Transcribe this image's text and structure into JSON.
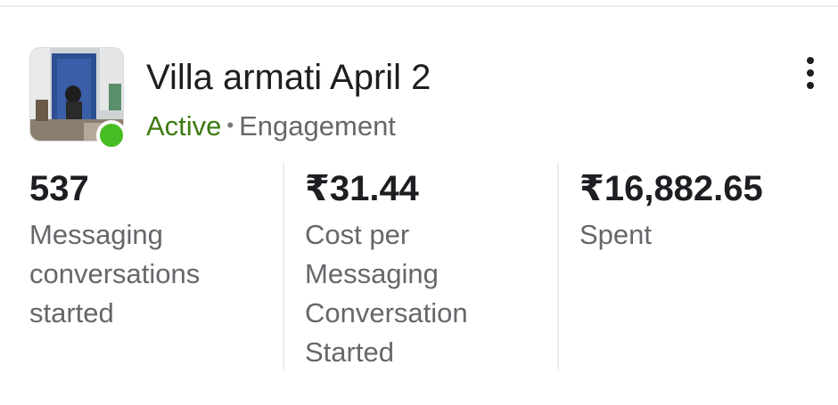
{
  "campaign": {
    "title": "Villa armati April 2",
    "status": "Active",
    "separator": "•",
    "objective": "Engagement",
    "thumbnail_icon": "campaign-thumbnail-image",
    "status_color": "#45bd25",
    "status_text_color": "#3d7b12"
  },
  "menu": {
    "icon": "more-vertical-icon"
  },
  "metrics": [
    {
      "value": "537",
      "label_lines": [
        "Messaging",
        "conversations",
        "started"
      ]
    },
    {
      "value": "₹31.44",
      "label_lines": [
        "Cost per",
        "Messaging",
        "Conversation",
        "Started"
      ]
    },
    {
      "value": "₹16,882.65",
      "label_lines": [
        "Spent"
      ]
    }
  ]
}
